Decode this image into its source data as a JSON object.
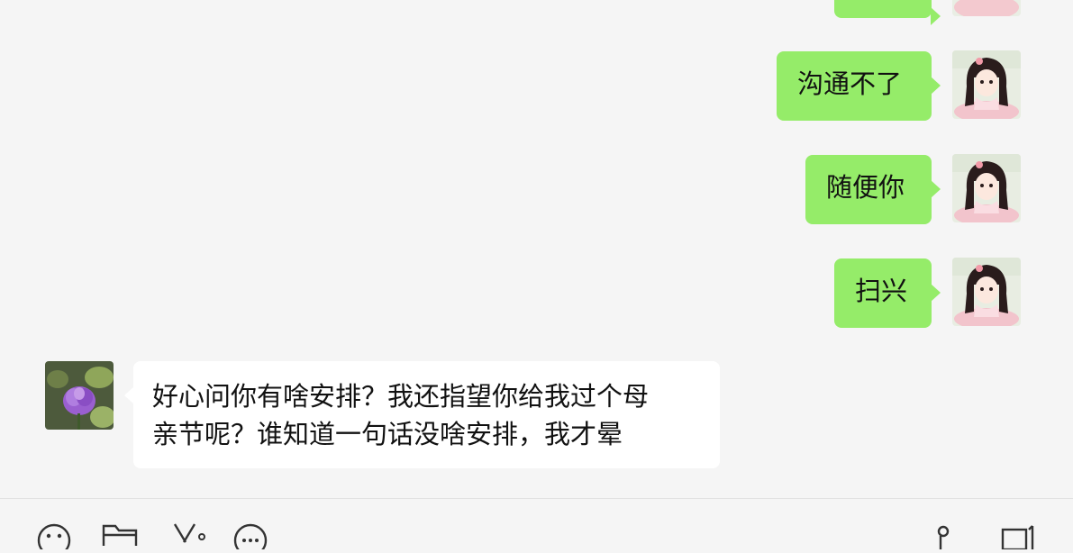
{
  "messages": [
    {
      "side": "out",
      "text": ""
    },
    {
      "side": "out",
      "text": "沟通不了"
    },
    {
      "side": "out",
      "text": "随便你"
    },
    {
      "side": "out",
      "text": "扫兴"
    },
    {
      "side": "in",
      "text": "好心问你有啥安排？我还指望你给我过个母亲节呢？谁知道一句话没啥安排，我才晕",
      "line1": "好心问你有啥安排？我还指望你给我过个母",
      "line2": "亲节呢？谁知道一句话没啥安排，我才晕"
    }
  ],
  "toolbar": {
    "icons": [
      "emoji-icon",
      "folder-icon",
      "scissors-icon",
      "chat-bubble-icon",
      "phone-icon",
      "video-call-icon"
    ]
  },
  "colors": {
    "outgoing_bubble": "#95ec69",
    "incoming_bubble": "#ffffff",
    "background": "#f5f5f5"
  }
}
